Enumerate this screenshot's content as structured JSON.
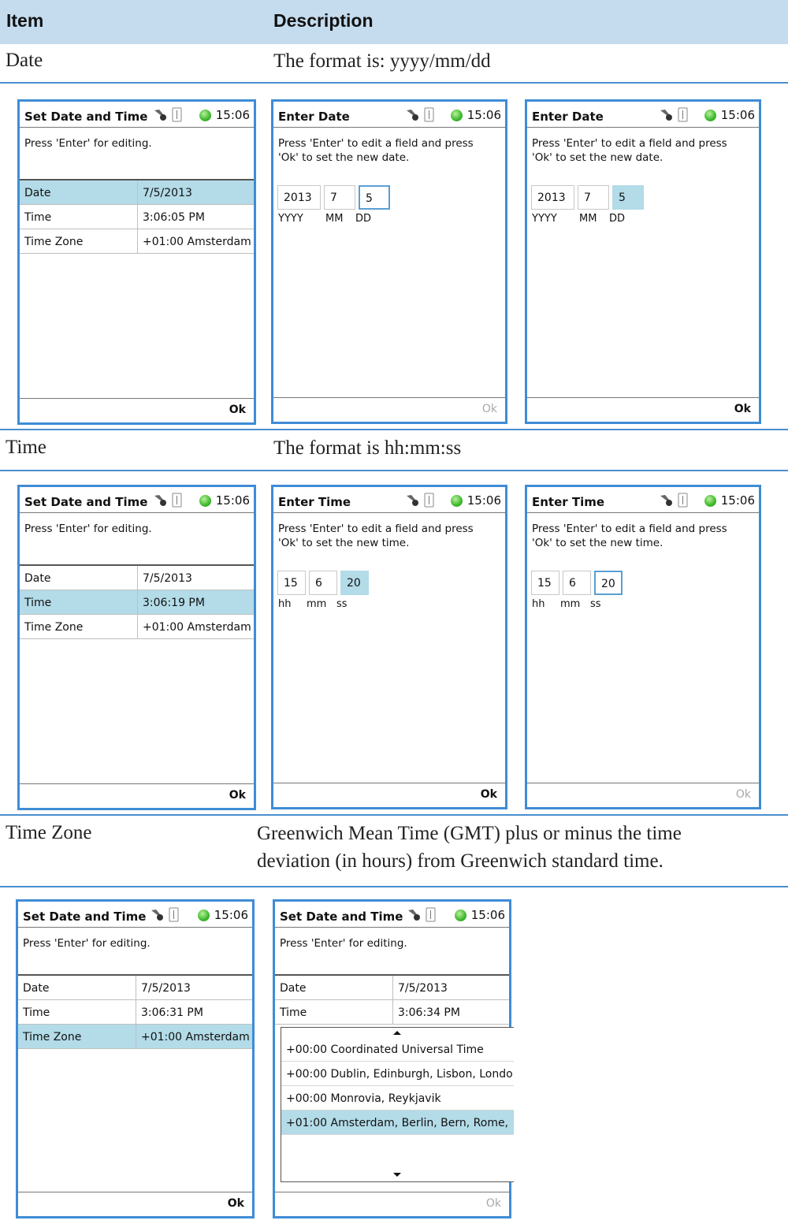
{
  "header": {
    "item": "Item",
    "description": "Description"
  },
  "rows": [
    {
      "item": "Date",
      "description": "The format is: yyyy/mm/dd"
    },
    {
      "item": "Time",
      "description": "The format is hh:mm:ss"
    },
    {
      "item": "Time Zone",
      "description_line1": "Greenwich Mean Time (GMT) plus or minus the time",
      "description_line2": "deviation (in hours) from Greenwich standard time."
    }
  ],
  "clock": "15:06",
  "ok_label": "Ok",
  "set_screen": {
    "title": "Set Date and Time",
    "instruction": "Press 'Enter' for editing.",
    "labels": {
      "date": "Date",
      "time": "Time",
      "tz": "Time Zone"
    },
    "date_value": "7/5/2013",
    "tz_value": "+01:00 Amsterdam",
    "time_values": [
      "3:06:05 PM",
      "3:06:19 PM",
      "3:06:31 PM",
      "3:06:34 PM"
    ]
  },
  "enter_date": {
    "title": "Enter Date",
    "instruction_1": "Press 'Enter' to edit a field and press",
    "instruction_2": "'Ok' to set the new date.",
    "year": "2013",
    "month": "7",
    "day": "5",
    "labels": [
      "YYYY",
      "MM",
      "DD"
    ]
  },
  "enter_time": {
    "title": "Enter Time",
    "instruction_1": "Press 'Enter' to edit a field and press",
    "instruction_2": "'Ok' to set the new time.",
    "hh": "15",
    "mm": "6",
    "ss": "20",
    "labels": [
      "hh",
      "mm",
      "ss"
    ]
  },
  "timezone_options": [
    "+00:00 Coordinated Universal Time",
    "+00:00 Dublin, Edinburgh, Lisbon, Londo",
    "+00:00 Monrovia, Reykjavik",
    "+01:00 Amsterdam, Berlin, Bern, Rome,"
  ],
  "colors": {
    "header_bg": "#c5dcef",
    "rule": "#4a8fd0",
    "screen_border": "#3f8cd6",
    "selection": "#b3dbe8"
  }
}
